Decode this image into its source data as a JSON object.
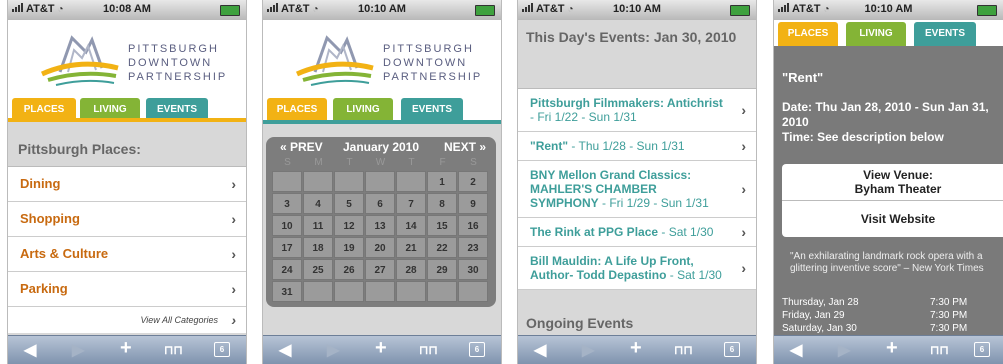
{
  "status": {
    "carrier": "AT&T"
  },
  "screens": [
    {
      "time": "10:08 AM"
    },
    {
      "time": "10:10 AM"
    },
    {
      "time": "10:10 AM"
    },
    {
      "time": "10:10 AM"
    }
  ],
  "logo": {
    "line1": "PITTSBURGH",
    "line2": "DOWNTOWN",
    "line3": "PARTNERSHIP"
  },
  "tabs": {
    "places": "PLACES",
    "living": "LIVING",
    "events": "EVENTS"
  },
  "places": {
    "title": "Pittsburgh Places:",
    "items": [
      "Dining",
      "Shopping",
      "Arts & Culture",
      "Parking"
    ],
    "view_all": "View All Categories"
  },
  "calendar": {
    "prev": "« PREV",
    "month": "January 2010",
    "next": "NEXT »",
    "dow": [
      "S",
      "M",
      "T",
      "W",
      "T",
      "F",
      "S"
    ],
    "weeks": [
      [
        "",
        "",
        "",
        "",
        "",
        "1",
        "2"
      ],
      [
        "3",
        "4",
        "5",
        "6",
        "7",
        "8",
        "9"
      ],
      [
        "10",
        "11",
        "12",
        "13",
        "14",
        "15",
        "16"
      ],
      [
        "17",
        "18",
        "19",
        "20",
        "21",
        "22",
        "23"
      ],
      [
        "24",
        "25",
        "26",
        "27",
        "28",
        "29",
        "30"
      ],
      [
        "31",
        "",
        "",
        "",
        "",
        "",
        ""
      ]
    ]
  },
  "events": {
    "title": "This Day's Events: Jan 30, 2010",
    "items": [
      {
        "title": "Pittsburgh Filmmakers: Antichrist",
        "dates": " - Fri 1/22 - Sun 1/31"
      },
      {
        "title": "\"Rent\"",
        "dates": " - Thu 1/28 - Sun 1/31"
      },
      {
        "title": "BNY Mellon Grand Classics: MAHLER'S CHAMBER SYMPHONY",
        "dates": " - Fri 1/29 - Sun 1/31"
      },
      {
        "title": "The Rink at PPG Place",
        "dates": " - Sat 1/30"
      },
      {
        "title": "Bill Mauldin: A Life Up Front, Author- Todd Depastino",
        "dates": " - Sat 1/30"
      }
    ],
    "ongoing": "Ongoing Events"
  },
  "detail": {
    "title": "\"Rent\"",
    "date_line": "Date: Thu Jan 28, 2010 - Sun Jan 31, 2010",
    "time_line": "Time: See description below",
    "venue_label": "View Venue:",
    "venue_name": "Byham Theater",
    "website": "Visit Website",
    "quote": "\"An exhilarating landmark rock opera with a glittering inventive score\" – New York Times",
    "showtimes": [
      {
        "day": "Thursday, Jan 28",
        "time": "7:30 PM"
      },
      {
        "day": "Friday, Jan 29",
        "time": "7:30 PM"
      },
      {
        "day": "Saturday, Jan 30",
        "time": "7:30 PM"
      }
    ]
  },
  "toolbar": {
    "back": "◀",
    "forward": "▶",
    "add": "+",
    "bookmarks": "⊓⊓",
    "pages": "6"
  },
  "colors": {
    "places": "#f2b214",
    "living": "#84b436",
    "events": "#3e9e9a",
    "link_orange": "#c86a10"
  }
}
